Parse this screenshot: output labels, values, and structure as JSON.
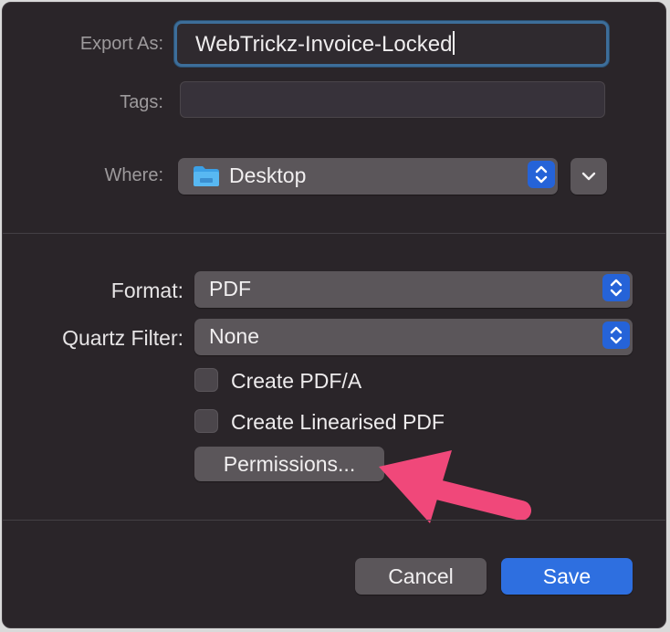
{
  "export": {
    "label": "Export As:",
    "value": "WebTrickz-Invoice-Locked"
  },
  "tags": {
    "label": "Tags:",
    "value": ""
  },
  "where": {
    "label": "Where:",
    "value": "Desktop",
    "icon": "folder-icon"
  },
  "format": {
    "label": "Format:",
    "value": "PDF"
  },
  "quartz": {
    "label": "Quartz Filter:",
    "value": "None"
  },
  "options": {
    "pdfa": {
      "label": "Create PDF/A",
      "checked": false
    },
    "linearised": {
      "label": "Create Linearised PDF",
      "checked": false
    }
  },
  "permissions": {
    "label": "Permissions..."
  },
  "buttons": {
    "cancel": "Cancel",
    "save": "Save"
  },
  "colors": {
    "accent": "#2e6fe0",
    "arrow": "#f0487a",
    "background": "#2a2529"
  }
}
